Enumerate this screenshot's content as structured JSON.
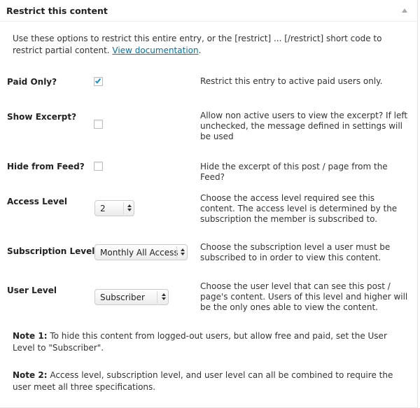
{
  "panel": {
    "title": "Restrict this content",
    "intro_text": "Use these options to restrict this entire entry, or the [restrict] ... [/restrict] short code to restrict partial content. ",
    "intro_link": "View documentation",
    "intro_tail": "."
  },
  "fields": {
    "paid_only": {
      "label": "Paid Only?",
      "checked": true,
      "description": "Restrict this entry to active paid users only."
    },
    "show_excerpt": {
      "label": "Show Excerpt?",
      "checked": false,
      "description": "Allow non active users to view the excerpt? If left unchecked, the message defined in settings will be used"
    },
    "hide_from_feed": {
      "label": "Hide from Feed?",
      "checked": false,
      "description": "Hide the excerpt of this post / page from the Feed?"
    },
    "access_level": {
      "label": "Access Level",
      "value": "2",
      "description": "Choose the access level required see this content. The access level is determined by the subscription the member is subscribed to."
    },
    "subscription_level": {
      "label": "Subscription Level",
      "value": "Monthly All Access",
      "description": "Choose the subscription level a user must be subscribed to in order to view this content."
    },
    "user_level": {
      "label": "User Level",
      "value": "Subscriber",
      "description": "Choose the user level that can see this post / page's content. Users of this level and higher will be the only ones able to view the content."
    }
  },
  "notes": [
    {
      "label": "Note 1:",
      "text": " To hide this content from logged-out users, but allow free and paid, set the User Level to \"Subscriber\"."
    },
    {
      "label": "Note 2:",
      "text": " Access level, subscription level, and user level can all be combined to require the user meet all three specifications."
    }
  ],
  "colors": {
    "link": "#0073aa",
    "checkmark": "#1e8cbe"
  }
}
